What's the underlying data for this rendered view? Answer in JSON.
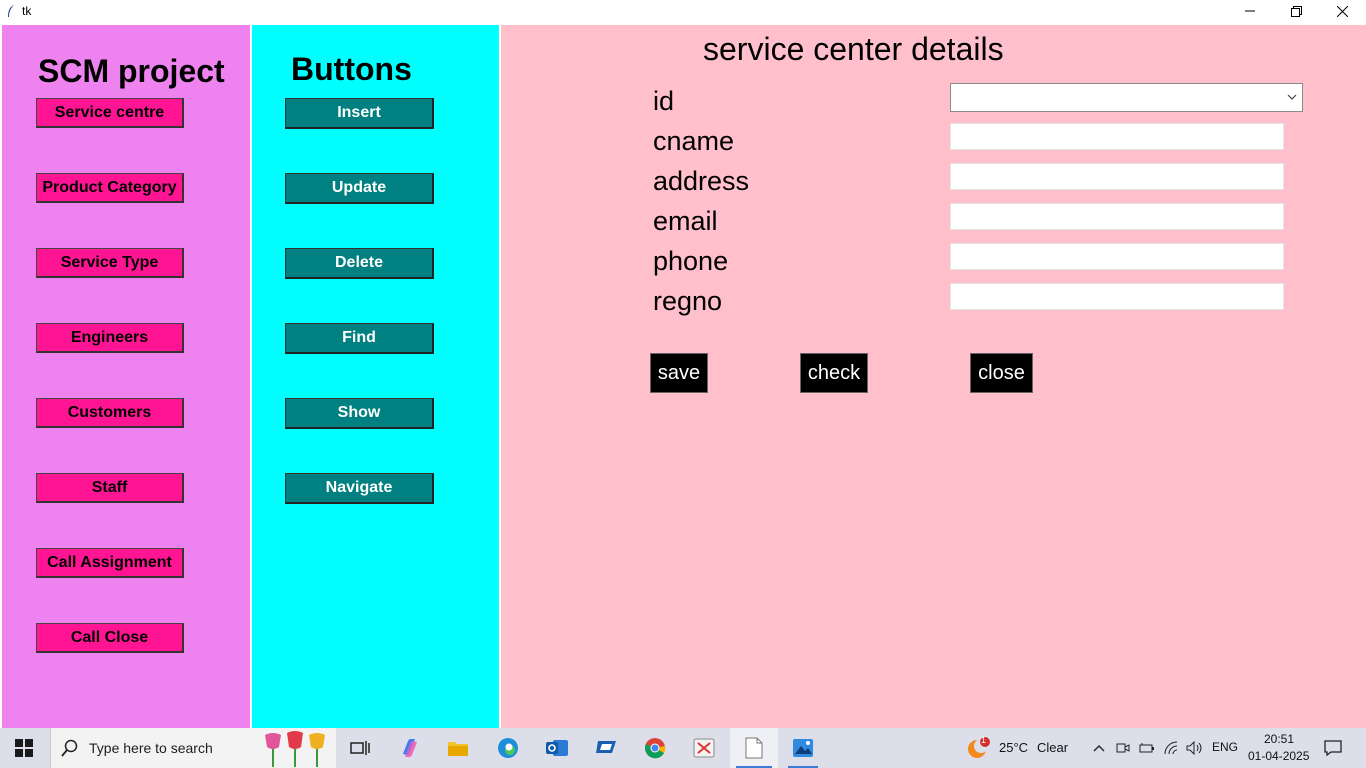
{
  "window": {
    "title": "tk"
  },
  "left_panel": {
    "heading": "SCM project",
    "buttons": [
      "Service centre",
      "Product Category",
      "Service Type",
      "Engineers",
      "Customers",
      "Staff",
      "Call Assignment",
      "Call Close"
    ]
  },
  "mid_panel": {
    "heading": "Buttons",
    "buttons": [
      "Insert",
      "Update",
      "Delete",
      "Find",
      "Show",
      "Navigate"
    ]
  },
  "form": {
    "title": "service center details",
    "fields": [
      {
        "label": "id",
        "value": ""
      },
      {
        "label": "cname",
        "value": ""
      },
      {
        "label": "address",
        "value": ""
      },
      {
        "label": "email",
        "value": ""
      },
      {
        "label": "phone",
        "value": ""
      },
      {
        "label": "regno",
        "value": ""
      }
    ],
    "actions": {
      "save": "save",
      "check": "check",
      "close": "close"
    }
  },
  "taskbar": {
    "search_placeholder": "Type here to search",
    "weather": {
      "temp": "25°C",
      "condition": "Clear",
      "badge": "1"
    },
    "language": "ENG",
    "time": "20:51",
    "date": "01-04-2025"
  },
  "colors": {
    "left_panel": "#ee82ee",
    "mid_panel": "#00ffff",
    "right_panel": "#ffc0cb",
    "pink_button": "#ff1493",
    "teal_button": "#008080"
  }
}
